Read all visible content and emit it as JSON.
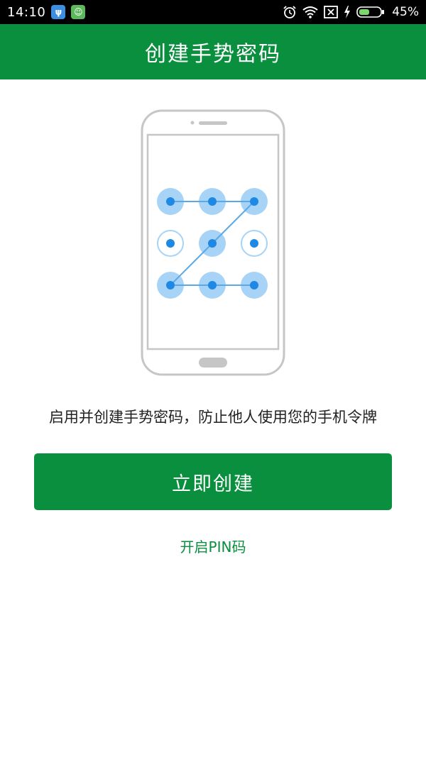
{
  "status_bar": {
    "time": "14:10",
    "battery_percent": "45%",
    "notification_icons": [
      "usb-icon",
      "android-icon"
    ],
    "system_icons": [
      "alarm-icon",
      "wifi-icon",
      "no-sim-icon",
      "charging-icon",
      "battery-icon"
    ]
  },
  "app_bar": {
    "title": "创建手势密码",
    "color": "#0a8f3f"
  },
  "illustration": {
    "icon": "phone-pattern-lock-icon",
    "accent_color": "#1e88e5"
  },
  "main": {
    "description": "启用并创建手势密码，防止他人使用您的手机令牌",
    "create_button_label": "立即创建",
    "pin_link_label": "开启PIN码"
  }
}
